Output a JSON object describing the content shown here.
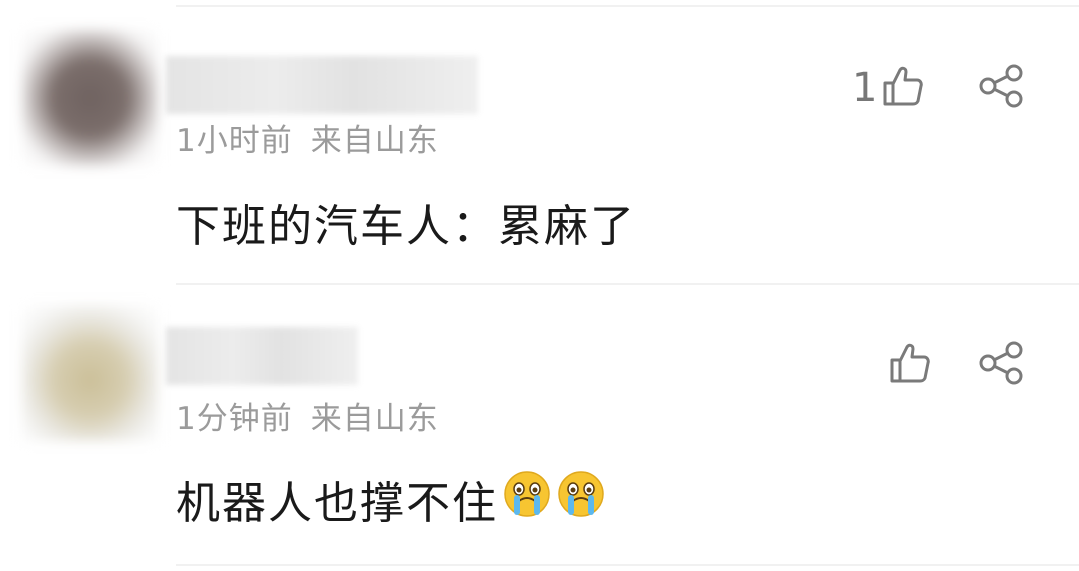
{
  "comments": [
    {
      "time": "1小时前",
      "location": "来自山东",
      "text": "下班的汽车人：累麻了",
      "like_count": "1",
      "avatar_color": "#6f6260",
      "emojis": []
    },
    {
      "time": "1分钟前",
      "location": "来自山东",
      "text": "机器人也撑不住",
      "like_count": "",
      "avatar_color": "#cbbf98",
      "emojis": [
        "crying-face",
        "crying-face"
      ]
    }
  ],
  "icons": {
    "like": "thumbs-up-icon",
    "share": "share-icon"
  },
  "colors": {
    "meta_text": "#9b9b9b",
    "content_text": "#1a1a1a",
    "icon_stroke": "#7a7a7a",
    "divider": "#f1f1f1"
  }
}
